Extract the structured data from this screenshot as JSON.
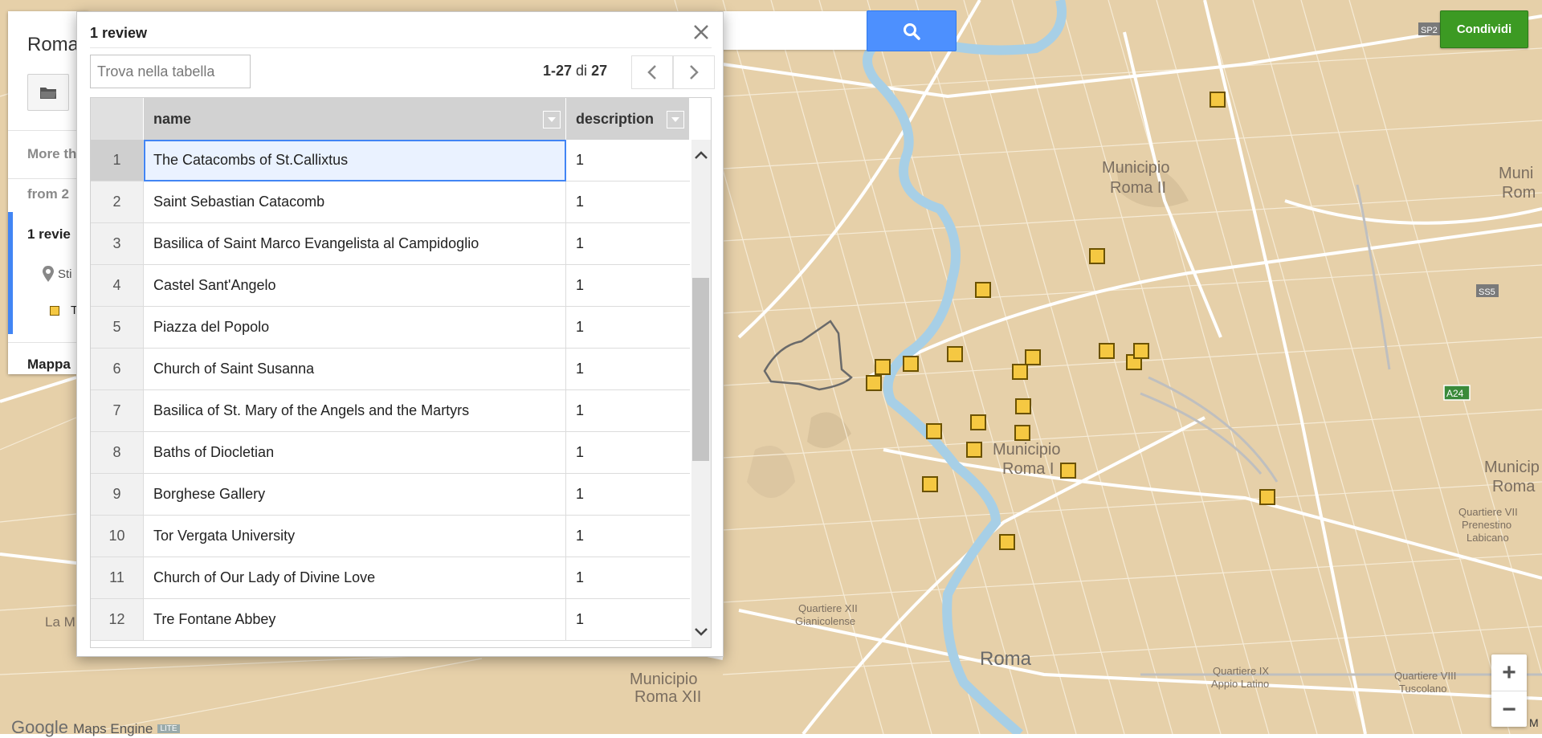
{
  "panel": {
    "title": "Roma",
    "more_text": "More th",
    "from_text": "from 2",
    "layer_title": "1 revie",
    "style_label": "Sti",
    "item_label": "T",
    "basemap_label": "Mappa"
  },
  "search": {
    "placeholder": ""
  },
  "share_label": "Condividi",
  "dialog": {
    "title": "1 review",
    "filter_placeholder": "Trova nella tabella",
    "pager_range": "1-27",
    "pager_of": "di",
    "pager_total": "27",
    "columns": {
      "name": "name",
      "description": "description"
    },
    "rows": [
      {
        "num": "1",
        "name": "The Catacombs of St.Callixtus",
        "desc": "1"
      },
      {
        "num": "2",
        "name": "Saint Sebastian Catacomb",
        "desc": "1"
      },
      {
        "num": "3",
        "name": "Basilica of Saint Marco Evangelista al Campidoglio",
        "desc": "1"
      },
      {
        "num": "4",
        "name": "Castel Sant'Angelo",
        "desc": "1"
      },
      {
        "num": "5",
        "name": "Piazza del Popolo",
        "desc": "1"
      },
      {
        "num": "6",
        "name": "Church of Saint Susanna",
        "desc": "1"
      },
      {
        "num": "7",
        "name": "Basilica of St. Mary of the Angels and the Martyrs",
        "desc": "1"
      },
      {
        "num": "8",
        "name": "Baths of Diocletian",
        "desc": "1"
      },
      {
        "num": "9",
        "name": "Borghese Gallery",
        "desc": "1"
      },
      {
        "num": "10",
        "name": "Tor Vergata University",
        "desc": "1"
      },
      {
        "num": "11",
        "name": "Church of Our Lady of Divine Love",
        "desc": "1"
      },
      {
        "num": "12",
        "name": "Tre Fontane Abbey",
        "desc": "1"
      }
    ]
  },
  "map_labels": {
    "municipio_ii_1": "Municipio",
    "municipio_ii_2": "Roma II",
    "municipio_i_1": "Municipio",
    "municipio_i_2": "Roma I",
    "municipio_xii_1": "Municipio",
    "municipio_xii_2": "Roma XII",
    "roma": "Roma",
    "quartiere_xii_1": "Quartiere XII",
    "quartiere_xii_2": "Gianicolense",
    "quartiere_ix_1": "Quartiere IX",
    "quartiere_ix_2": "Appio Latino",
    "quartiere_viii_1": "Quartiere VIII",
    "quartiere_viii_2": "Tuscolano",
    "quartiere_vii_1": "Quartiere VII",
    "quartiere_vii_2": "Prenestino",
    "quartiere_vii_3": "Labicano",
    "muni_right_1": "Muni",
    "muni_right_2": "Rom",
    "municip_r_1": "Municip",
    "municip_r_2": "Roma",
    "la_m": "La M",
    "shield_sp2": "SP2",
    "shield_ss5": "SS5",
    "shield_a24": "A24"
  },
  "footer": {
    "google": "Google",
    "maps_engine": "Maps Engine",
    "beta": "LITE",
    "corner": "M"
  },
  "colors": {
    "land": "#e6d0a9",
    "water": "#a7cfe6",
    "road": "#ffffff",
    "marker_fill": "#f5c842",
    "marker_border": "#6b5200",
    "share": "#3c9a23",
    "search": "#4d90fe"
  },
  "icons": {
    "search": "search-icon",
    "close": "close-icon",
    "folder": "folder-icon",
    "prev": "chevron-left-icon",
    "next": "chevron-right-icon",
    "up": "chevron-up-icon",
    "down": "chevron-down-icon",
    "zoom_in": "plus-icon",
    "zoom_out": "minus-icon"
  }
}
